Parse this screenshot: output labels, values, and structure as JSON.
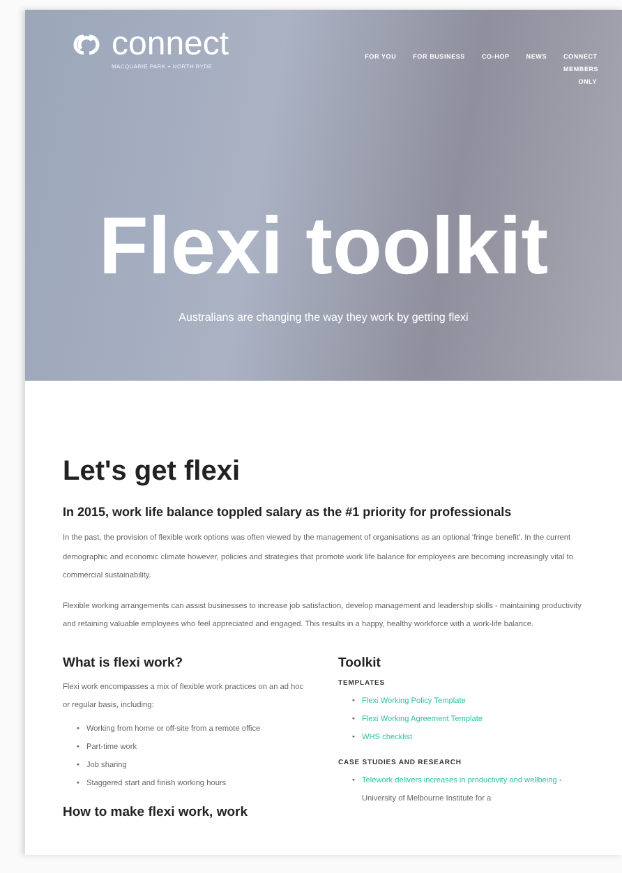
{
  "header": {
    "logo": {
      "name": "connect",
      "tagline": "MACQUARIE PARK + NORTH RYDE"
    },
    "nav": [
      "FOR YOU",
      "FOR BUSINESS",
      "CO-HOP",
      "NEWS",
      "CONNECT MEMBERS ONLY"
    ]
  },
  "hero": {
    "title": "Flexi toolkit",
    "subtitle": "Australians are changing the way they work by getting flexi"
  },
  "intro": {
    "title": "Let's get flexi",
    "subtitle": "In 2015, work life balance toppled salary as the #1 priority for professionals",
    "paragraphs": [
      "In the past, the provision of flexible work options was often viewed by the management of organisations as an optional 'fringe benefit'. In the current demographic and economic climate however, policies and strategies that promote work life balance for employees are becoming increasingly vital to commercial sustainability.",
      "Flexible working arrangements can assist businesses to increase job satisfaction, develop management and leadership skills - maintaining productivity and retaining valuable employees who feel appreciated and engaged. This results in a happy, healthy workforce with a work-life balance."
    ]
  },
  "what_is": {
    "title": "What is flexi work?",
    "text": "Flexi work encompasses a mix of flexible work practices on an ad hoc or regular basis, including:",
    "marker": "•",
    "items": [
      "Working from home or off-site from a remote office",
      "Part-time work",
      "Job sharing",
      "Staggered start and finish working hours"
    ],
    "next_title": "How to make flexi work, work"
  },
  "toolkit": {
    "title": "Toolkit",
    "marker": "•",
    "sections": [
      {
        "heading": "TEMPLATES",
        "items": [
          {
            "link": "Flexi Working Policy Template"
          },
          {
            "link": "Flexi Working Agreement Template"
          },
          {
            "link": "WHS checklist"
          }
        ]
      },
      {
        "heading": "CASE STUDIES AND RESEARCH",
        "items": [
          {
            "link": "Telework delivers increases in productivity and wellbeing",
            "text": " - University of Melbourne Institute for a"
          }
        ]
      }
    ]
  }
}
